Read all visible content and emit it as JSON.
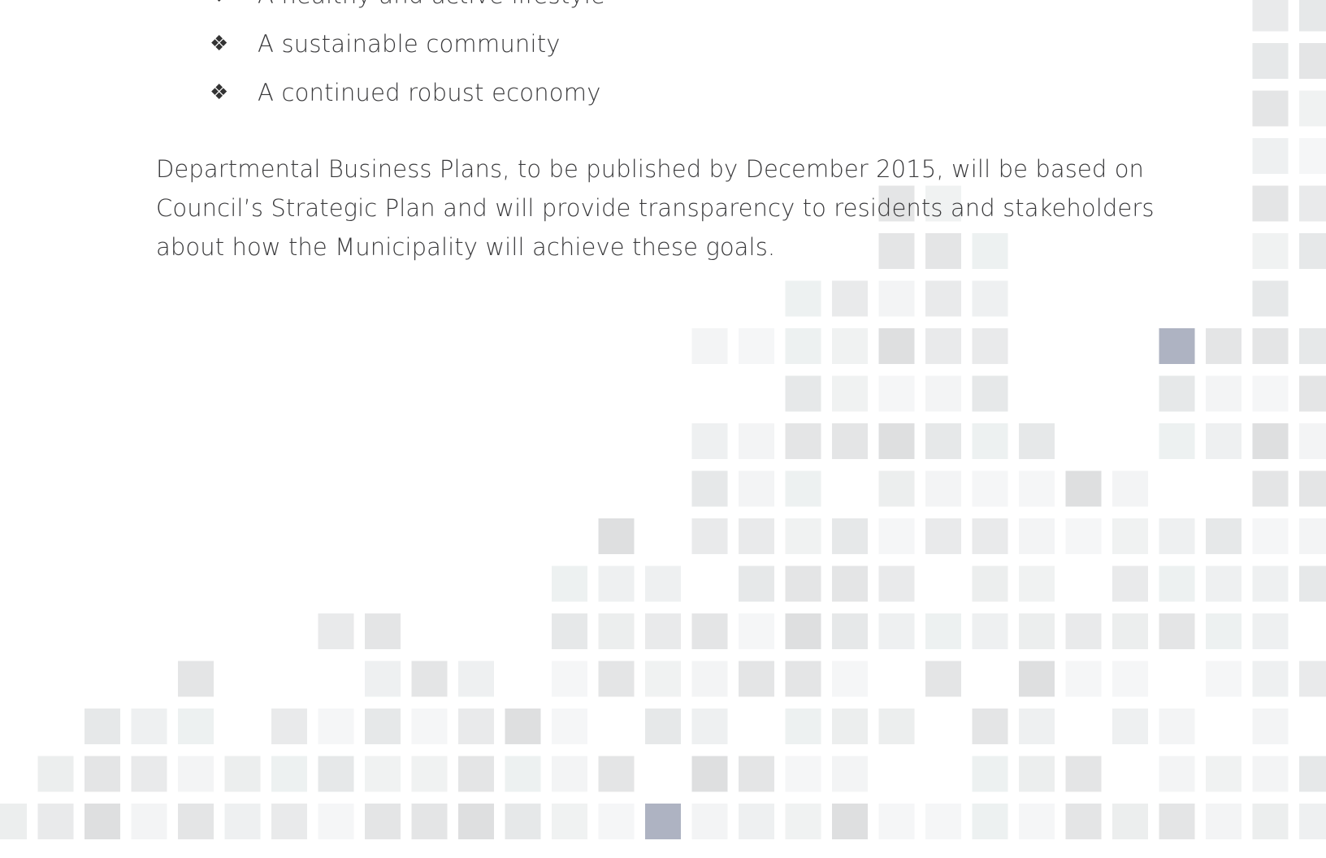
{
  "bullets": [
    {
      "glyph": "❖",
      "text": "A healthy and active lifestyle"
    },
    {
      "glyph": "❖",
      "text": "A sustainable community"
    },
    {
      "glyph": "❖",
      "text": "A continued robust economy"
    }
  ],
  "paragraph": {
    "line1": "Departmental Business Plans, to be published by December 2015, will be based on",
    "line2": "Council’s Strategic Plan and will provide transparency to residents and stakeholders",
    "line3": "about how the Municipality will achieve these goals."
  },
  "colors": {
    "text": "#3a3a3c",
    "tile_light": "#f1f2f3",
    "tile_mid": "#e2e3e4",
    "tile_accent": "#aeb3c2"
  }
}
